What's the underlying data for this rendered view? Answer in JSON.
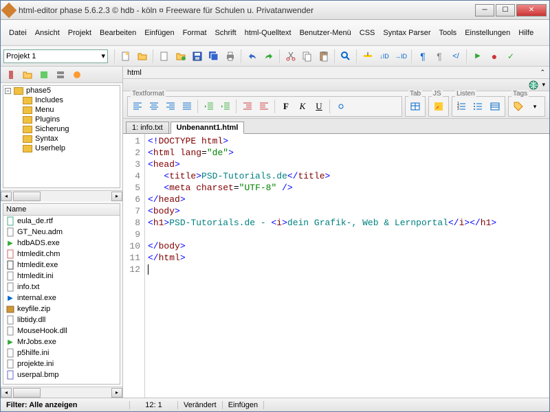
{
  "window": {
    "title": "html-editor phase 5.6.2.3  ©   hdb - köln  ¤  Freeware für Schulen u. Privatanwender"
  },
  "menu": [
    "Datei",
    "Ansicht",
    "Projekt",
    "Bearbeiten",
    "Einfügen",
    "Format",
    "Schrift",
    "html-Quelltext",
    "Benutzer-Menü",
    "CSS",
    "Syntax Parser",
    "Tools",
    "Einstellungen",
    "Hilfe"
  ],
  "toolbar": {
    "project": "Projekt 1"
  },
  "tree": {
    "root": "phase5",
    "children": [
      "Includes",
      "Menu",
      "Plugins",
      "Sicherung",
      "Syntax",
      "Userhelp"
    ]
  },
  "filelist": {
    "header": "Name",
    "items": [
      {
        "name": "eula_de.rtf",
        "icon": "doc"
      },
      {
        "name": "GT_Neu.adm",
        "icon": "cfg"
      },
      {
        "name": "hdbADS.exe",
        "icon": "exe-green"
      },
      {
        "name": "htmledit.chm",
        "icon": "chm"
      },
      {
        "name": "htmledit.exe",
        "icon": "exe"
      },
      {
        "name": "htmledit.ini",
        "icon": "ini"
      },
      {
        "name": "info.txt",
        "icon": "txt"
      },
      {
        "name": "internal.exe",
        "icon": "exe-blue"
      },
      {
        "name": "keyfile.zip",
        "icon": "zip"
      },
      {
        "name": "libtidy.dll",
        "icon": "dll"
      },
      {
        "name": "MouseHook.dll",
        "icon": "dll"
      },
      {
        "name": "MrJobs.exe",
        "icon": "exe-green"
      },
      {
        "name": "p5hilfe.ini",
        "icon": "ini"
      },
      {
        "name": "projekte.ini",
        "icon": "ini"
      },
      {
        "name": "userpal.bmp",
        "icon": "bmp"
      }
    ]
  },
  "editor": {
    "path": "html",
    "groups": {
      "textformat": "Textformat",
      "tab": "Tab",
      "js": "JS",
      "listen": "Listen",
      "tags": "Tags"
    },
    "tabs": [
      {
        "label": "1: info.txt",
        "active": false
      },
      {
        "label": "Unbenannt1.html",
        "active": true
      }
    ],
    "lines": 12
  },
  "status": {
    "filter": "Filter: Alle anzeigen",
    "pos": "12: 1",
    "modified": "Verändert",
    "mode": "Einfügen"
  }
}
